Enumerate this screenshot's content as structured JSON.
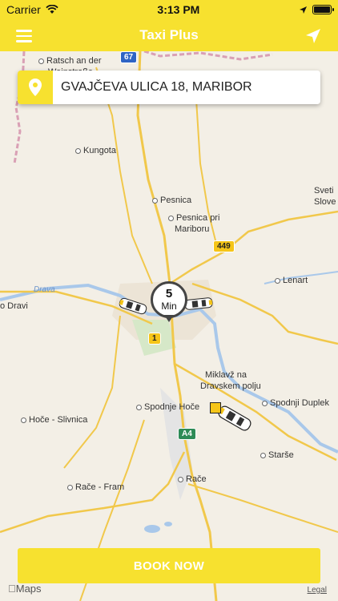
{
  "status_bar": {
    "carrier": "Carrier",
    "time": "3:13 PM",
    "battery_level": 1.0
  },
  "nav": {
    "title": "Taxi Plus",
    "menu_icon": "hamburger-menu-icon",
    "locate_icon": "location-arrow-icon"
  },
  "address": {
    "text": "GVAJČEVA ULICA 18, MARIBOR",
    "icon": "map-pin-icon"
  },
  "eta": {
    "value": "5",
    "unit": "Min"
  },
  "map": {
    "places": [
      "Ratsch an der",
      "Weinstraße",
      "Kungota",
      "Pesnica",
      "Pesnica pri",
      "Mariboru",
      "Sveti",
      "Slove",
      "Lenart",
      "o Dravi",
      "Miklavž na",
      "Dravskem polju",
      "Spodnji Duplek",
      "Hoče - Slivnica",
      "Spodnje Hoče",
      "Starše",
      "Rače - Fram",
      "Rače"
    ],
    "river": "Drava",
    "road_badges": [
      "67",
      "449",
      "1",
      "A4"
    ]
  },
  "book_button": {
    "label": "BOOK NOW"
  },
  "attribution": {
    "maps": "Maps",
    "legal": "Legal"
  }
}
